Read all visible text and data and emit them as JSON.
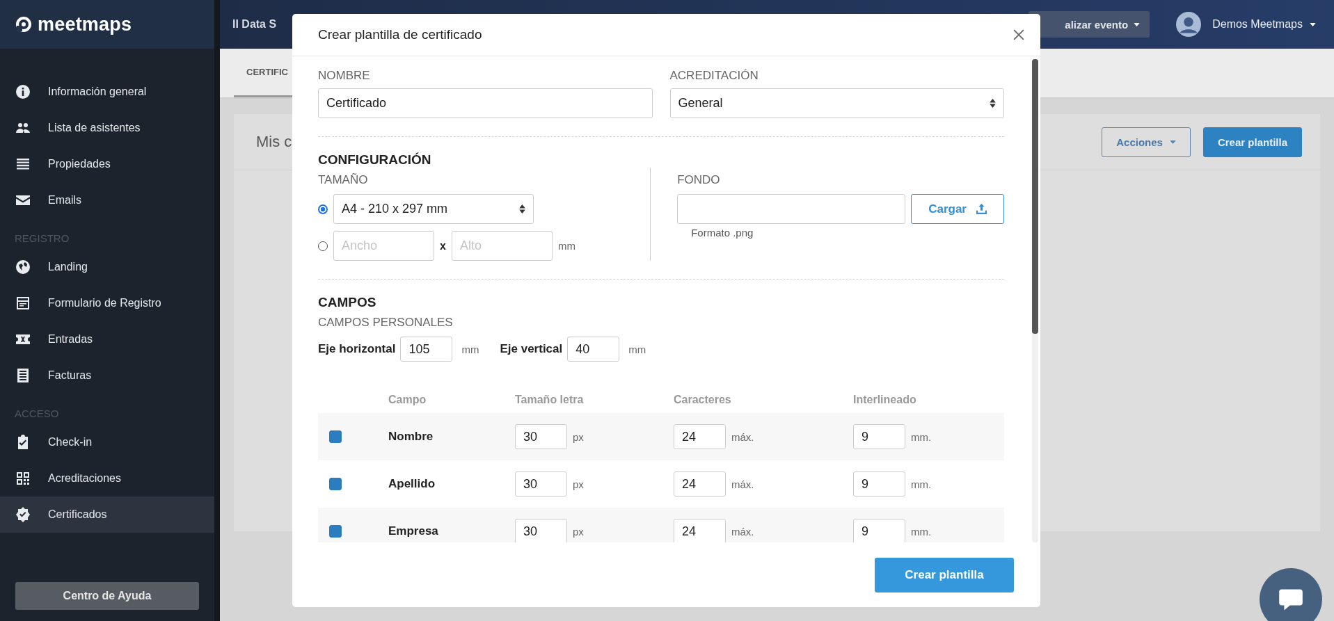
{
  "sidebar": {
    "logo": "meetmaps",
    "items": [
      {
        "kind": "item",
        "label": "Información general",
        "selected": false
      },
      {
        "kind": "item",
        "label": "Lista de asistentes",
        "selected": false
      },
      {
        "kind": "item",
        "label": "Propiedades",
        "selected": false
      },
      {
        "kind": "item",
        "label": "Emails",
        "selected": false
      },
      {
        "kind": "heading",
        "label": "REGISTRO"
      },
      {
        "kind": "item",
        "label": "Landing",
        "selected": false
      },
      {
        "kind": "item",
        "label": "Formulario de Registro",
        "selected": false
      },
      {
        "kind": "item",
        "label": "Entradas",
        "selected": false
      },
      {
        "kind": "item",
        "label": "Facturas",
        "selected": false
      },
      {
        "kind": "heading",
        "label": "ACCESO"
      },
      {
        "kind": "item",
        "label": "Check-in",
        "selected": false
      },
      {
        "kind": "item",
        "label": "Acreditaciones",
        "selected": false
      },
      {
        "kind": "item",
        "label": "Certificados",
        "selected": true
      }
    ],
    "help_button": "Centro de Ayuda"
  },
  "header": {
    "event_title": "II Data S",
    "event_button": "alizar evento",
    "user": "Demos Meetmaps"
  },
  "tabs": [
    {
      "label": "CERTIFIC",
      "selected": true
    }
  ],
  "card": {
    "title": "Mis c",
    "buttons": [
      {
        "label": "Acciones",
        "kind": "outline"
      },
      {
        "label": "Crear plantilla",
        "kind": "primary"
      }
    ]
  },
  "modal": {
    "title": "Crear plantilla de certificado",
    "name": {
      "label": "NOMBRE",
      "value": "Certificado"
    },
    "accreditation": {
      "label": "ACREDITACIÓN",
      "value": "General"
    },
    "configuration": {
      "heading": "CONFIGURACIÓN",
      "size_label": "TAMAÑO",
      "size_options": [
        {
          "kind": "preset",
          "selected": true,
          "value": "A4 - 210 x 297 mm"
        },
        {
          "kind": "custom",
          "selected": false,
          "width_placeholder": "Ancho",
          "separator": "x",
          "height_placeholder": "Alto",
          "unit": "mm"
        }
      ],
      "background": {
        "label": "FONDO",
        "button": "Cargar",
        "hint": "Formato .png"
      }
    },
    "fields": {
      "heading": "CAMPOS",
      "subheading": "CAMPOS PERSONALES",
      "axes": [
        {
          "label": "Eje horizontal",
          "value": "105",
          "unit": "mm"
        },
        {
          "label": "Eje vertical",
          "value": "40",
          "unit": "mm"
        }
      ],
      "columns": [
        "Campo",
        "Tamaño letra",
        "Caracteres",
        "Interlineado"
      ],
      "rows": [
        {
          "checked": true,
          "name": "Nombre",
          "font_size": "30",
          "font_unit": "px",
          "chars": "24",
          "chars_unit": "máx.",
          "spacing": "9",
          "spacing_unit": "mm."
        },
        {
          "checked": true,
          "name": "Apellido",
          "font_size": "30",
          "font_unit": "px",
          "chars": "24",
          "chars_unit": "máx.",
          "spacing": "9",
          "spacing_unit": "mm."
        },
        {
          "checked": true,
          "name": "Empresa",
          "font_size": "30",
          "font_unit": "px",
          "chars": "24",
          "chars_unit": "máx.",
          "spacing": "9",
          "spacing_unit": "mm."
        }
      ]
    },
    "submit": "Crear plantilla"
  }
}
